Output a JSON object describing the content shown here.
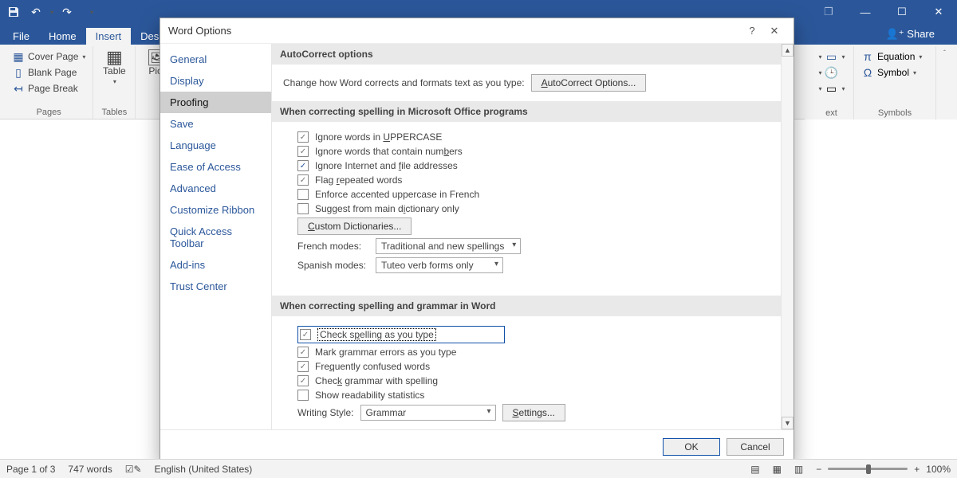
{
  "titlebar": {
    "qat_undo": "↶",
    "qat_redo": "↷",
    "win_restore": "❐",
    "win_min": "—",
    "win_max": "☐",
    "win_close": "✕"
  },
  "tabs": {
    "file": "File",
    "home": "Home",
    "insert": "Insert",
    "design": "Des"
  },
  "share": "Share",
  "ribbon": {
    "pages_label": "Pages",
    "cover_page": "Cover Page",
    "blank_page": "Blank Page",
    "page_break": "Page Break",
    "tables_label": "Tables",
    "table": "Table",
    "pictures": "Pict",
    "text_label": "ext",
    "symbols_label": "Symbols",
    "equation": "Equation",
    "symbol": "Symbol"
  },
  "dialog": {
    "title": "Word Options",
    "nav": {
      "general": "General",
      "display": "Display",
      "proofing": "Proofing",
      "save": "Save",
      "language": "Language",
      "ease": "Ease of Access",
      "advanced": "Advanced",
      "ribbon": "Customize Ribbon",
      "qat": "Quick Access Toolbar",
      "addins": "Add-ins",
      "trust": "Trust Center"
    },
    "section_autocorrect": "AutoCorrect options",
    "autocorrect_desc": "Change how Word corrects and formats text as you type:",
    "autocorrect_btn_prefix": "A",
    "autocorrect_btn_rest": "utoCorrect Options...",
    "section_spelling_office": "When correcting spelling in Microsoft Office programs",
    "cb_uppercase_pre": "Ignore words in ",
    "cb_uppercase_u": "U",
    "cb_uppercase_post": "PPERCASE",
    "cb_numbers_pre": "Ignore words that contain num",
    "cb_numbers_u": "b",
    "cb_numbers_post": "ers",
    "cb_internet_pre": "Ignore Internet and ",
    "cb_internet_u": "f",
    "cb_internet_post": "ile addresses",
    "cb_repeated_pre": "Flag ",
    "cb_repeated_u": "r",
    "cb_repeated_post": "epeated words",
    "cb_french": "Enforce accented uppercase in French",
    "cb_dictionary_pre": "Suggest from main d",
    "cb_dictionary_u": "i",
    "cb_dictionary_post": "ctionary only",
    "custom_dict_u": "C",
    "custom_dict_rest": "ustom Dictionaries...",
    "french_modes_label": "French modes:",
    "french_modes_value": "Traditional and new spellings",
    "spanish_modes_label": "Spanish modes:",
    "spanish_modes_value": "Tuteo verb forms only",
    "section_spelling_word": "When correcting spelling and grammar in Word",
    "cb_checkspell_pre": "Check s",
    "cb_checkspell_u": "p",
    "cb_checkspell_post": "elling as you type",
    "cb_checkspell_label": "Check spelling as you type",
    "cb_grammar_type": "Mark grammar errors as you type",
    "cb_confused_pre": "Fre",
    "cb_confused_u": "q",
    "cb_confused_post": "uently confused words",
    "cb_grammar_spell_pre": "Chec",
    "cb_grammar_spell_u": "k",
    "cb_grammar_spell_post": " grammar with spelling",
    "cb_readability": "Show readability statistics",
    "writing_style_pre": "Writin",
    "writing_style_u": "g",
    "writing_style_post": " Style:",
    "writing_style_value": "Grammar",
    "settings_u": "S",
    "settings_rest": "ettings...",
    "ok": "OK",
    "cancel": "Cancel"
  },
  "status": {
    "page": "Page 1 of 3",
    "words": "747 words",
    "lang": "English (United States)",
    "zoom_minus": "−",
    "zoom_plus": "+",
    "zoom_pct": "100%"
  }
}
